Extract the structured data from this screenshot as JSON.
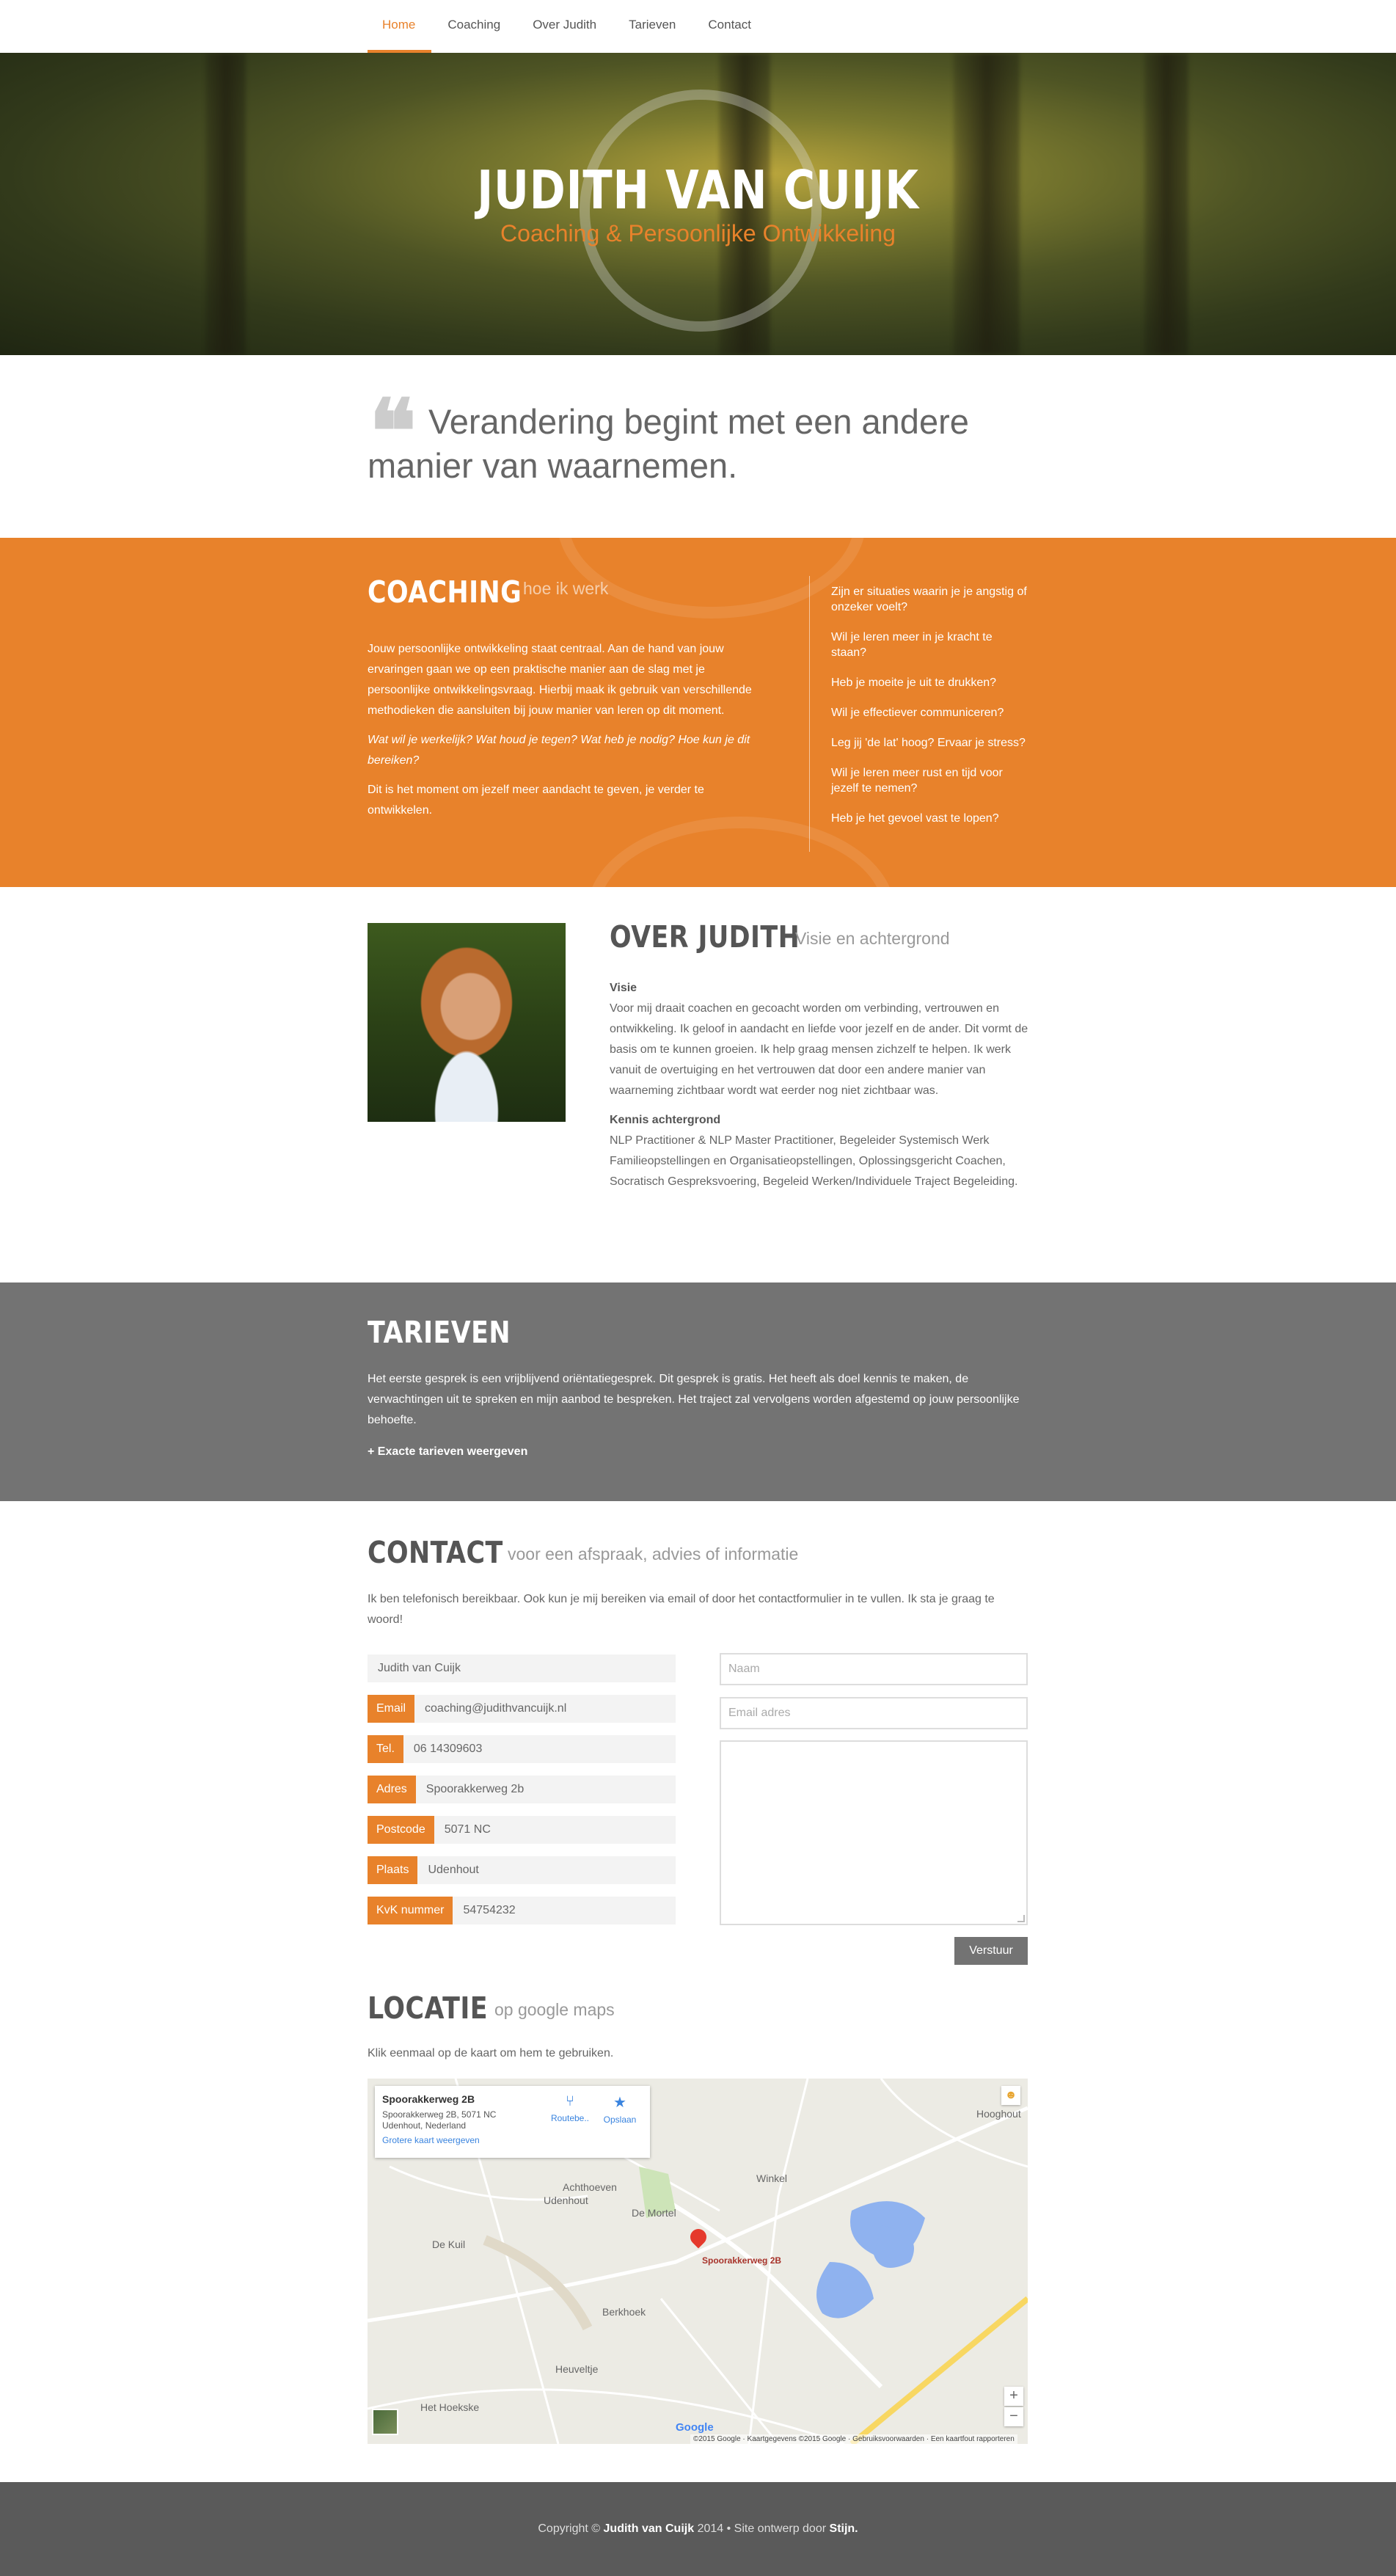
{
  "nav": {
    "items": [
      "Home",
      "Coaching",
      "Over Judith",
      "Tarieven",
      "Contact"
    ]
  },
  "hero": {
    "title": "JUDITH VAN CUIJK",
    "subtitle": "Coaching & Persoonlijke Ontwikkeling"
  },
  "quote": {
    "text": "Verandering begint met een andere manier van waarnemen."
  },
  "coaching": {
    "title": "COACHING",
    "subtitle": "hoe ik werk",
    "paragraph1": "Jouw persoonlijke ontwikkeling staat centraal. Aan de hand van jouw ervaringen gaan we op een praktische manier aan de slag met je persoonlijke ontwikkelingsvraag. Hierbij maak ik gebruik van verschillende methodieken die aansluiten bij jouw manier van leren op dit moment.",
    "paragraph2": "Wat wil je werkelijk? Wat houd je tegen? Wat heb je nodig? Hoe kun je dit bereiken?",
    "paragraph3": "Dit is het moment om jezelf meer aandacht te geven, je verder te ontwikkelen.",
    "questions": [
      "Zijn er situaties waarin je je angstig of onzeker voelt?",
      "Wil je leren meer in je kracht te staan?",
      "Heb je moeite je uit te drukken?",
      "Wil je effectiever communiceren?",
      "Leg jij 'de lat' hoog? Ervaar je stress?",
      "Wil je leren meer rust en tijd voor jezelf te nemen?",
      "Heb je het gevoel vast te lopen?"
    ]
  },
  "over": {
    "title": "OVER JUDITH",
    "subtitle": "Visie en achtergrond",
    "visie_label": "Visie",
    "visie_text": "Voor mij draait coachen en gecoacht worden om verbinding, vertrouwen en ontwikkeling. Ik geloof in aandacht en liefde voor jezelf en de ander. Dit vormt de basis om te kunnen groeien. Ik help graag mensen zichzelf te helpen. Ik werk vanuit de overtuiging en het vertrouwen dat door een andere manier van waarneming zichtbaar wordt wat eerder nog niet zichtbaar was.",
    "kennis_label": "Kennis achtergrond",
    "kennis_text": "NLP Practitioner & NLP Master Practitioner, Begeleider Systemisch Werk Familieopstellingen en Organisatieopstellingen, Oplossingsgericht Coachen, Socratisch Gespreksvoering, Begeleid Werken/Individuele Traject Begeleiding."
  },
  "tarieven": {
    "title": "TARIEVEN",
    "text": "Het eerste gesprek is een vrijblijvend oriëntatiegesprek. Dit gesprek is gratis. Het heeft als doel kennis te maken, de verwachtingen uit te spreken en mijn aanbod te bespreken. Het traject zal vervolgens worden afgestemd op jouw persoonlijke behoefte.",
    "link": "+ Exacte tarieven weergeven"
  },
  "contact": {
    "title": "CONTACT",
    "subtitle": "voor een afspraak, advies of informatie",
    "intro": "Ik ben telefonisch bereikbaar. Ook kun je mij bereiken via email of door het contactformulier in te vullen. Ik sta je graag te woord!",
    "name": "Judith van Cuijk",
    "rows": [
      {
        "label": "Email",
        "value": "coaching@judithvancuijk.nl"
      },
      {
        "label": "Tel.",
        "value": "06 14309603"
      },
      {
        "label": "Adres",
        "value": "Spoorakkerweg 2b"
      },
      {
        "label": "Postcode",
        "value": "5071 NC"
      },
      {
        "label": "Plaats",
        "value": "Udenhout"
      },
      {
        "label": "KvK nummer",
        "value": "54754232"
      }
    ],
    "form": {
      "name_placeholder": "Naam",
      "email_placeholder": "Email adres",
      "submit": "Verstuur"
    }
  },
  "locatie": {
    "title": "LOCATIE",
    "subtitle": "op google maps",
    "intro": "Klik eenmaal op de kaart om hem te gebruiken.",
    "map": {
      "place_title": "Spoorakkerweg 2B",
      "address": "Spoorakkerweg 2B, 5071 NC Udenhout, Nederland",
      "larger_map": "Grotere kaart weergeven",
      "route_label": "Routebe..",
      "save_label": "Opslaan",
      "pin_label": "Spoorakkerweg 2B",
      "place_names": [
        "Hooghout",
        "Winkel",
        "Achthoeven",
        "Udenhout",
        "De Mortel",
        "De Kuil",
        "Berkhoek",
        "Heuveltje",
        "Het Hoekske"
      ],
      "zoom_in": "+",
      "zoom_out": "−",
      "google": "Google",
      "credits": "©2015 Google · Kaartgegevens ©2015 Google · Gebruiksvoorwaarden · Een kaartfout rapporteren"
    }
  },
  "footer": {
    "prefix": "Copyright ©",
    "name": "Judith van Cuijk",
    "year": "2014  •  Site ontwerp door",
    "designer": "Stijn."
  }
}
